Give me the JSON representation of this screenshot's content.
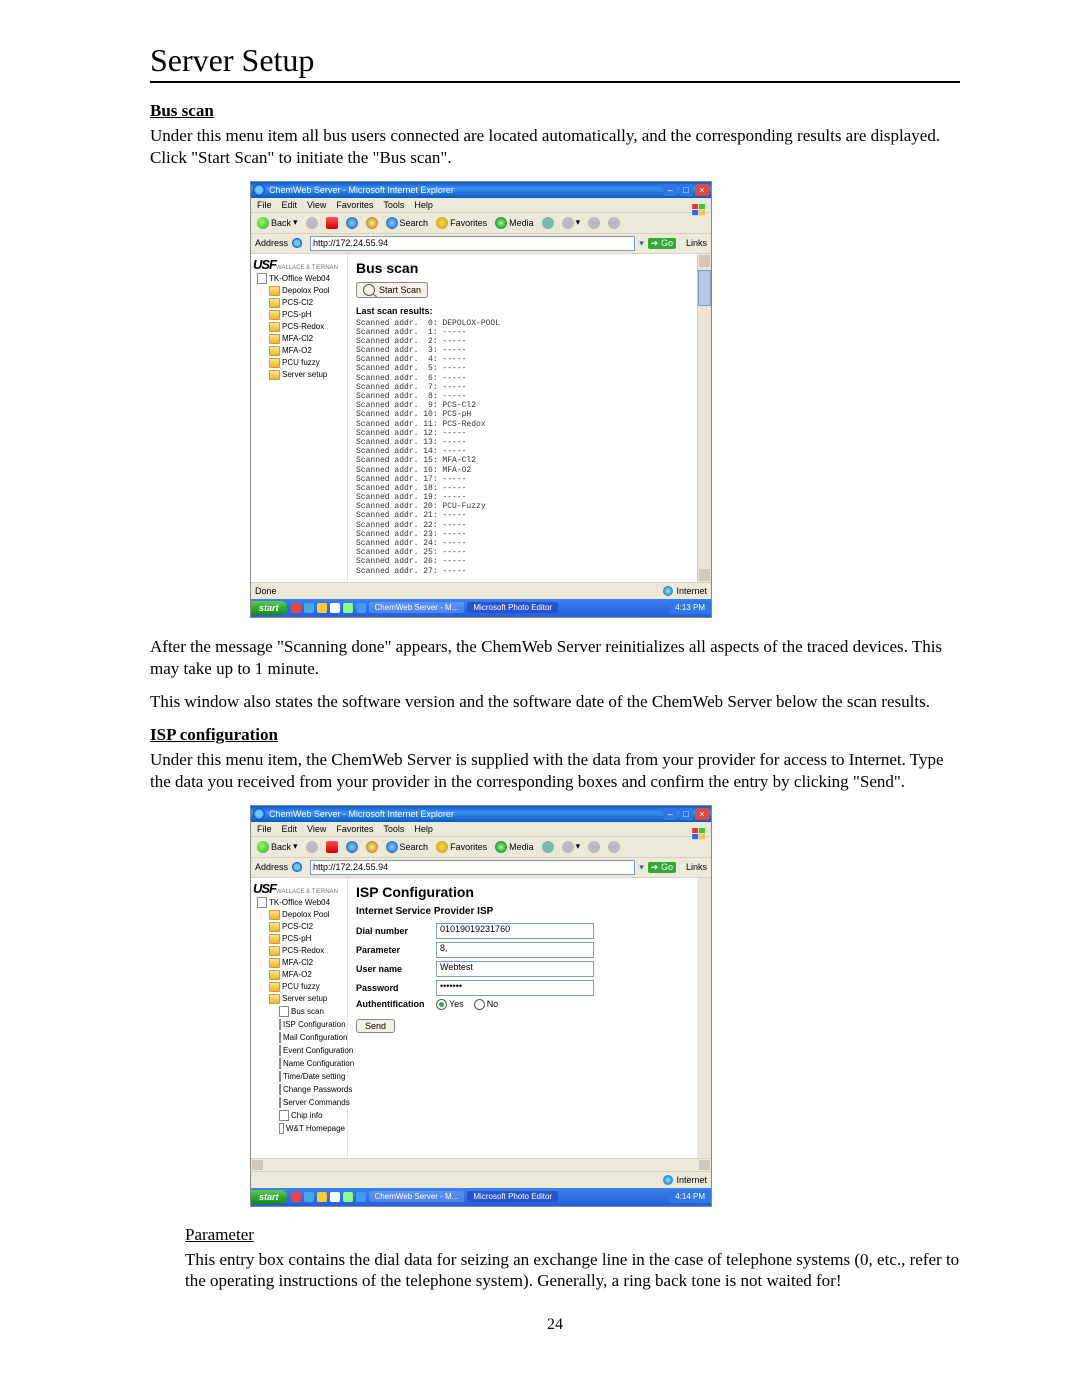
{
  "pageTitle": "Server Setup",
  "pageNumber": "24",
  "section1": {
    "heading": "Bus scan",
    "intro": "Under this menu item all bus users connected are located automatically, and the corresponding results are displayed. Click \"Start Scan\" to initiate the \"Bus scan\".",
    "after1": "After the message \"Scanning done\" appears, the ChemWeb Server reinitializes all aspects of the traced devices. This may take up to 1 minute.",
    "after2": "This window also states the software version and the software date of the ChemWeb Server below the scan results."
  },
  "section2": {
    "heading": "ISP configuration",
    "intro": "Under this menu item, the ChemWeb Server is supplied with the data from your provider for access to Internet. Type the data you received from your provider in the corresponding boxes and confirm the entry by clicking \"Send\".",
    "paramHeading": "Parameter",
    "paramBody": "This entry box contains the dial data for seizing an exchange line in the case of telephone systems (0, etc., refer to the operating instructions of the telephone system). Generally, a ring back tone is not waited for!"
  },
  "ie": {
    "windowTitle": "ChemWeb Server - Microsoft Internet Explorer",
    "menu": [
      "File",
      "Edit",
      "View",
      "Favorites",
      "Tools",
      "Help"
    ],
    "back": "Back",
    "search": "Search",
    "favorites": "Favorites",
    "media": "Media",
    "addressLabel": "Address",
    "addressValue": "http://172.24.55.94",
    "go": "Go",
    "links": "Links",
    "statusDone": "Done",
    "statusZone": "Internet",
    "taskbarStart": "start",
    "taskbarApp1": "ChemWeb Server - M...",
    "taskbarApp2": "Microsoft Photo Editor",
    "clock1": "4:13 PM",
    "clock2": "4:14 PM"
  },
  "tree1": {
    "root": "TK-Office Web04",
    "items": [
      "Depolox Pool",
      "PCS-Cl2",
      "PCS-pH",
      "PCS-Redox",
      "MFA-Cl2",
      "MFA-O2",
      "PCU fuzzy",
      "Server setup"
    ]
  },
  "tree2": {
    "root": "TK-Office Web04",
    "items": [
      "Depolox Pool",
      "PCS-Cl2",
      "PCS-pH",
      "PCS-Redox",
      "MFA-Cl2",
      "MFA-O2",
      "PCU fuzzy"
    ],
    "serverSetup": "Server setup",
    "sub": [
      "Bus scan",
      "ISP Configuration",
      "Mail Configuration",
      "Event Configuration",
      "Name Configuration",
      "Time/Date setting",
      "Change Passwords",
      "Server Commands",
      "Chip info",
      "W&T Homepage"
    ]
  },
  "busscan": {
    "title": "Bus scan",
    "startBtn": "Start Scan",
    "lastResults": "Last scan results:",
    "lines": [
      "Scanned addr.  0: DEPOLOX-POOL",
      "Scanned addr.  1: -----",
      "Scanned addr.  2: -----",
      "Scanned addr.  3: -----",
      "Scanned addr.  4: -----",
      "Scanned addr.  5: -----",
      "Scanned addr.  6: -----",
      "Scanned addr.  7: -----",
      "Scanned addr.  8: -----",
      "Scanned addr.  9: PCS-Cl2",
      "Scanned addr. 10: PCS-pH",
      "Scanned addr. 11: PCS-Redox",
      "Scanned addr. 12: -----",
      "Scanned addr. 13: -----",
      "Scanned addr. 14: -----",
      "Scanned addr. 15: MFA-Cl2",
      "Scanned addr. 16: MFA-O2",
      "Scanned addr. 17: -----",
      "Scanned addr. 18: -----",
      "Scanned addr. 19: -----",
      "Scanned addr. 20: PCU-Fuzzy",
      "Scanned addr. 21: -----",
      "Scanned addr. 22: -----",
      "Scanned addr. 23: -----",
      "Scanned addr. 24: -----",
      "Scanned addr. 25: -----",
      "Scanned addr. 26: -----",
      "Scanned addr. 27: -----"
    ]
  },
  "isp": {
    "title": "ISP Configuration",
    "subtitle": "Internet Service Provider ISP",
    "labels": {
      "dial": "Dial number",
      "param": "Parameter",
      "user": "User name",
      "pass": "Password",
      "auth": "Authentification"
    },
    "values": {
      "dial": "01019019231760",
      "param": "8,",
      "user": "Webtest",
      "pass": "•••••••",
      "authYes": "Yes",
      "authNo": "No"
    },
    "send": "Send"
  },
  "brand": {
    "name": "USF",
    "sub": "WALLACE & TIERNAN"
  }
}
